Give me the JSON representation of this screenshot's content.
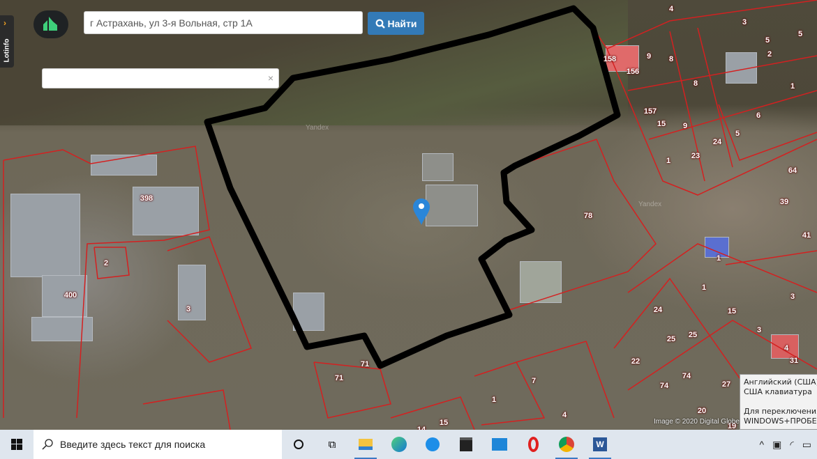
{
  "app": {
    "sidebar_tab_label": "Lotinfo",
    "search_value": "г Астрахань, ул 3-я Вольная, стр 1А",
    "search_button": "Найти",
    "secondary_input_value": "",
    "clear_icon": "×"
  },
  "map": {
    "watermarks": [
      "Yandex",
      "Yandex"
    ],
    "credit": "Image © 2020 Digital Globe",
    "parcel_labels": [
      "158",
      "156",
      "9",
      "8",
      "8",
      "5",
      "2",
      "1",
      "157",
      "15",
      "9",
      "24",
      "5",
      "6",
      "23",
      "1",
      "64",
      "39",
      "41",
      "1",
      "1",
      "3",
      "15",
      "24",
      "3",
      "25",
      "25",
      "4",
      "31",
      "22",
      "74",
      "74",
      "27",
      "20",
      "19",
      "398",
      "2",
      "400",
      "3",
      "78",
      "4",
      "3",
      "5",
      "71",
      "71",
      "7",
      "1",
      "4",
      "15",
      "14"
    ],
    "outline_color": "#000000",
    "parcel_color": "#d42020",
    "marker_color": "#2a86d9"
  },
  "tooltip": {
    "line1": "Английский (США)",
    "line2": "США клавиатура",
    "line3": "Для переключения",
    "line4": "WINDOWS+ПРОБЕЛ"
  },
  "taskbar": {
    "search_placeholder": "Введите здесь текст для поиска",
    "apps": [
      "cortana",
      "task-view",
      "file-explorer",
      "edge",
      "teamviewer",
      "store",
      "mail",
      "opera",
      "chrome",
      "word"
    ]
  }
}
